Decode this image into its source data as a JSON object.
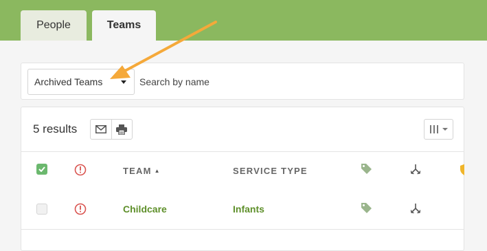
{
  "tabs": [
    {
      "label": "People",
      "active": false
    },
    {
      "label": "Teams",
      "active": true
    }
  ],
  "filter": {
    "selected": "Archived Teams",
    "search_placeholder": "Search by name"
  },
  "results": {
    "count_label": "5 results"
  },
  "table": {
    "header": {
      "team_label": "TEAM",
      "service_type_label": "SERVICE TYPE",
      "sort_indicator": "▲"
    },
    "rows": [
      {
        "team": "Childcare",
        "service_type": "Infants",
        "selected": false
      }
    ]
  },
  "icons": {
    "tabs_bar": "none",
    "email": "envelope-icon",
    "print": "printer-icon",
    "columns": "columns-icon",
    "alert": "alert-circle-icon",
    "tag": "tag-icon",
    "merge": "merge-icon",
    "shield": "shield-icon"
  },
  "colors": {
    "header_bar": "#8bb85f",
    "link": "#5e8f2a",
    "alert": "#d9534f",
    "checkbox": "#6bb86e",
    "tag": "#9ab58c",
    "shield": "#f0b52a",
    "annotation_arrow": "#f5a93a"
  }
}
